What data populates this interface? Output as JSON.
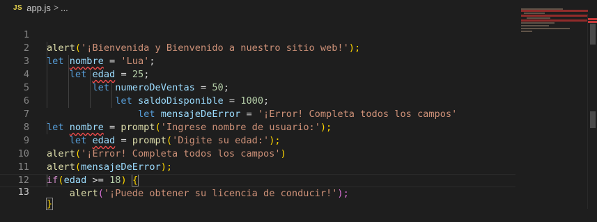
{
  "breadcrumb": {
    "lang_badge": "JS",
    "file": "app.js",
    "separator": ">",
    "more": "..."
  },
  "lines": {
    "n1": "1",
    "n2": "2",
    "n3": "3",
    "n4": "4",
    "n5": "5",
    "n6": "6",
    "n7": "7",
    "n8": "8",
    "n9": "9",
    "n10": "10",
    "n11": "11",
    "n12": "12",
    "n13": "13"
  },
  "code": {
    "l1": {
      "fn": "alert",
      "open": "(",
      "str": "'¡Bienvenida y Bienvenido a nuestro sitio web!'",
      "close": ");"
    },
    "l2": {
      "kw": "let",
      "var": "nombre",
      "op": "=",
      "str": "'Lua'",
      "end": ";"
    },
    "l3": {
      "kw": "let",
      "var": "edad",
      "op": "=",
      "num": "25",
      "end": ";"
    },
    "l4": {
      "kw": "let",
      "var": "numeroDeVentas",
      "op": "=",
      "num": "50",
      "end": ";"
    },
    "l5": {
      "kw": "let",
      "var": "saldoDisponible",
      "op": "=",
      "num": "1000",
      "end": ";"
    },
    "l6": {
      "kw": "let",
      "var": "mensajeDeError",
      "op": "=",
      "str": "'¡Error! Completa todos los campos'"
    },
    "l7": {
      "kw": "let",
      "var": "nombre",
      "op": "=",
      "fn": "prompt",
      "open": "(",
      "str": "'Ingrese nombre de usuario:'",
      "close": ");"
    },
    "l8": {
      "kw": "let",
      "var": "edad",
      "op": "=",
      "fn": "prompt",
      "open": "(",
      "str": "'Digite su edad:'",
      "close": ");"
    },
    "l9": {
      "fn": "alert",
      "open": "(",
      "str": "'¡Error! Completa todos los campos'",
      "close": ")"
    },
    "l10": {
      "fn": "alert",
      "open": "(",
      "var": "mensajeDeError",
      "close": ");"
    },
    "l11": {
      "kw": "if",
      "open": "(",
      "var": "edad",
      "op": ">=",
      "num": "18",
      "close": ")",
      "brace": "{"
    },
    "l12": {
      "fn": "alert",
      "open": "(",
      "str": "'¡Puede obtener su licencia de conducir!'",
      "close": ");"
    },
    "l13": {
      "brace": "}"
    }
  },
  "colors": {
    "background": "#1e1e1e",
    "keyword": "#569cd6",
    "control": "#c586c0",
    "function": "#dcdcaa",
    "variable": "#9cdcfe",
    "string": "#ce9178",
    "number": "#b5cea8",
    "error_squiggle": "#f14c4c"
  }
}
